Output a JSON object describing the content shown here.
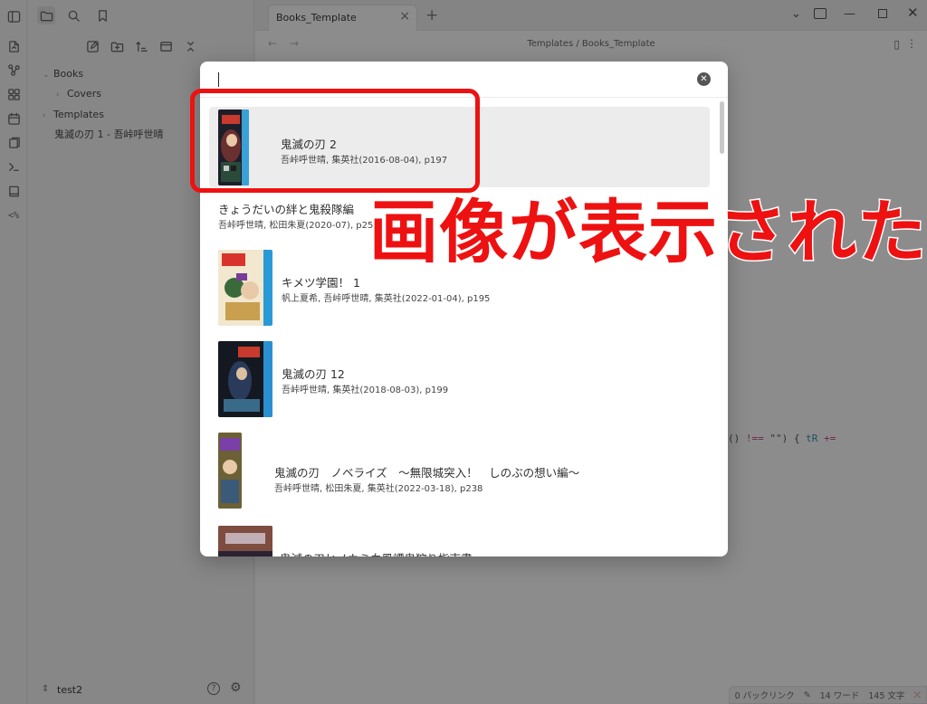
{
  "ribbon": {
    "icons": [
      "open-quick-switcher-icon",
      "graph-view-icon",
      "canvas-icon",
      "daily-note-icon",
      "templates-icon",
      "command-palette-icon",
      "books-icon",
      "templater-icon"
    ],
    "templater_label": "<%"
  },
  "sidebar": {
    "top_buttons": [
      "files-icon",
      "search-icon",
      "bookmark-icon"
    ],
    "nav_buttons": [
      "new-note-icon",
      "new-folder-icon",
      "sort-icon",
      "collapse-icon",
      "close-all-icon"
    ],
    "tree": [
      {
        "label": "Books",
        "expanded": true
      },
      {
        "label": "Covers",
        "expanded": false
      },
      {
        "label": "Templates",
        "expanded": false
      },
      {
        "label": "鬼滅の刃 1 - 吾峠呼世晴"
      }
    ],
    "vault_name": "test2"
  },
  "workspace": {
    "tab_title": "Books_Template",
    "breadcrumb": "Templates / Books_Template",
    "code_fragment": {
      "a": "() ",
      "op": "!==",
      "b": " \"\") { ",
      "var": "tR",
      "op2": " +="
    },
    "status": {
      "backlinks": "0 バックリンク",
      "words": "14 ワード",
      "chars": "145 文字"
    }
  },
  "modal": {
    "search_value": "",
    "results": [
      {
        "title": "鬼滅の刃 2",
        "meta": "吾峠呼世晴, 集英社(2016-08-04), p197",
        "has_cover": true,
        "selected": true,
        "cover_colors": [
          "#1e1e2a",
          "#3aa0d8",
          "#c83a2e"
        ]
      },
      {
        "title": "きょうだいの絆と鬼殺隊編",
        "meta": "吾峠呼世晴, 松田朱夏(2020-07), p258",
        "has_cover": false,
        "selected": false
      },
      {
        "title": "キメツ学園！ 1",
        "meta": "帆上夏希, 吾峠呼世晴, 集英社(2022-01-04), p195",
        "has_cover": true,
        "selected": false,
        "cover_colors": [
          "#f2e7cf",
          "#2a9ad6",
          "#d8342c"
        ]
      },
      {
        "title": "鬼滅の刃 12",
        "meta": "吾峠呼世晴, 集英社(2018-08-03), p199",
        "has_cover": true,
        "selected": false,
        "cover_colors": [
          "#141820",
          "#2a8fd0",
          "#3a6a8a"
        ]
      },
      {
        "title": "鬼滅の刃　ノベライズ　～無限城突入！　しのぶの想い編～",
        "meta": "吾峠呼世晴, 松田朱夏, 集英社(2022-03-18), p238",
        "has_cover": true,
        "selected": false,
        "cover_colors": [
          "#2a2a3a",
          "#e8c530",
          "#7a3fa8"
        ]
      },
      {
        "title": "鬼滅の刃ヒノカミ血風譚鬼狩り指南書",
        "meta": "",
        "has_cover": true,
        "selected": false,
        "cover_colors": [
          "#2a2233",
          "#b86a4a",
          "#e0d8e8"
        ]
      }
    ]
  },
  "annotation": {
    "text": "画像が表示された",
    "color": "#ee1111"
  }
}
